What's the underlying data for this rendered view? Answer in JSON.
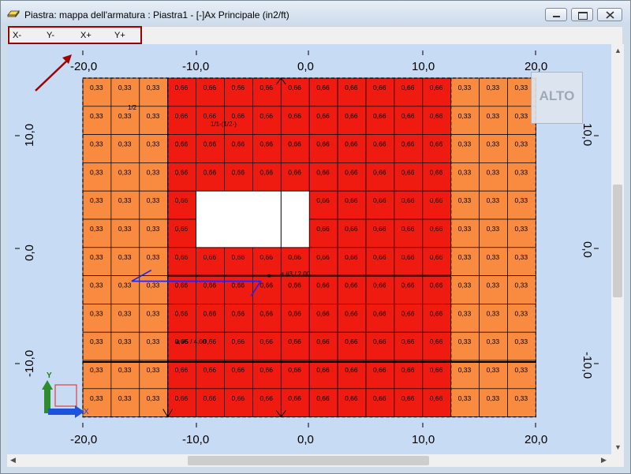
{
  "window": {
    "title": "Piastra: mappa dell'armatura : Piastra1 - [-]Ax Principale (in2/ft)"
  },
  "tabs": [
    {
      "label": "X-"
    },
    {
      "label": "Y-"
    },
    {
      "label": "X+"
    },
    {
      "label": "Y+"
    }
  ],
  "axes": {
    "x_ticks": [
      "-20,0",
      "-10,0",
      "0,0",
      "10,0",
      "20,0"
    ],
    "y_ticks": [
      "10,0",
      "0,0",
      "-10,0"
    ],
    "y_axis_label": "Y",
    "x_axis_label": "X"
  },
  "alto_label": "ALTO",
  "annotations": {
    "span_top": "1/2",
    "span_mid": "1/1-(1/2-)",
    "rebar1": "ø #3 / 2.00",
    "rebar2": "ø #5 / 4.00"
  },
  "map": {
    "cols": 16,
    "rows": 12,
    "values": {
      "low": "0,33",
      "high": "0,66"
    },
    "high_cols": [
      3,
      12
    ],
    "highlight_cell": {
      "row": 10,
      "col": 15,
      "value": "0,33"
    },
    "hole": {
      "rows": [
        4,
        5
      ],
      "cols": [
        4,
        7
      ]
    },
    "colors": {
      "low": "#f98b40",
      "high": "#f01b10",
      "background": "#c7dbf5",
      "hole": "#ffffff"
    }
  }
}
